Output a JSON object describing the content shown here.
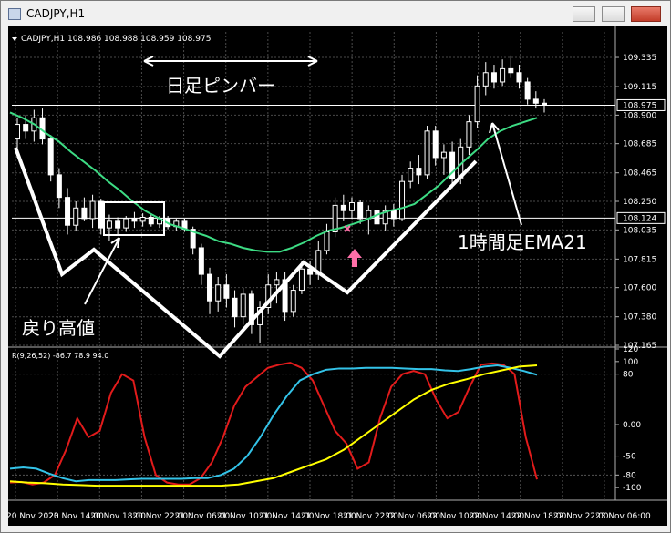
{
  "window": {
    "title": "CADJPY,H1"
  },
  "chart_data": [
    {
      "type": "candlestick",
      "title": "CADJPY,H1  108.986 108.988 108.959 108.975",
      "ylim": [
        107.165,
        109.5
      ],
      "y_ticks": [
        "109.335",
        "109.115",
        "108.900",
        "108.685",
        "108.465",
        "108.250",
        "108.035",
        "107.815",
        "107.600",
        "107.380",
        "107.165"
      ],
      "x_ticks": [
        "20 Nov 2023",
        "20 Nov 14:00",
        "20 Nov 18:00",
        "20 Nov 22:00",
        "21 Nov 06:00",
        "21 Nov 10:00",
        "21 Nov 14:00",
        "21 Nov 18:00",
        "21 Nov 22:00",
        "22 Nov 06:00",
        "22 Nov 10:00",
        "22 Nov 14:00",
        "22 Nov 18:00",
        "22 Nov 22:00",
        "23 Nov 06:00"
      ],
      "price_labels": [
        {
          "label": "108.975",
          "value": 108.975,
          "color": "#ffffff"
        },
        {
          "label": "108.124",
          "value": 108.124,
          "color": "#ffffff"
        }
      ],
      "horizontal_lines": [
        108.975,
        108.124
      ],
      "candles": [
        {
          "o": 108.72,
          "h": 108.88,
          "l": 108.58,
          "c": 108.83
        },
        {
          "o": 108.83,
          "h": 108.9,
          "l": 108.72,
          "c": 108.78
        },
        {
          "o": 108.78,
          "h": 108.94,
          "l": 108.7,
          "c": 108.88
        },
        {
          "o": 108.88,
          "h": 108.95,
          "l": 108.68,
          "c": 108.72
        },
        {
          "o": 108.72,
          "h": 108.75,
          "l": 108.4,
          "c": 108.45
        },
        {
          "o": 108.45,
          "h": 108.5,
          "l": 108.2,
          "c": 108.28
        },
        {
          "o": 108.28,
          "h": 108.35,
          "l": 108.0,
          "c": 108.07
        },
        {
          "o": 108.07,
          "h": 108.25,
          "l": 108.03,
          "c": 108.2
        },
        {
          "o": 108.2,
          "h": 108.28,
          "l": 108.1,
          "c": 108.12
        },
        {
          "o": 108.12,
          "h": 108.3,
          "l": 108.05,
          "c": 108.25
        },
        {
          "o": 108.25,
          "h": 108.27,
          "l": 108.0,
          "c": 108.05
        },
        {
          "o": 108.05,
          "h": 108.15,
          "l": 107.95,
          "c": 108.1
        },
        {
          "o": 108.1,
          "h": 108.13,
          "l": 108.0,
          "c": 108.05
        },
        {
          "o": 108.05,
          "h": 108.14,
          "l": 108.02,
          "c": 108.12
        },
        {
          "o": 108.12,
          "h": 108.17,
          "l": 108.05,
          "c": 108.1
        },
        {
          "o": 108.1,
          "h": 108.16,
          "l": 108.06,
          "c": 108.13
        },
        {
          "o": 108.13,
          "h": 108.16,
          "l": 108.06,
          "c": 108.08
        },
        {
          "o": 108.08,
          "h": 108.14,
          "l": 108.05,
          "c": 108.12
        },
        {
          "o": 108.12,
          "h": 108.14,
          "l": 108.04,
          "c": 108.06
        },
        {
          "o": 108.06,
          "h": 108.12,
          "l": 108.03,
          "c": 108.1
        },
        {
          "o": 108.1,
          "h": 108.12,
          "l": 108.02,
          "c": 108.04
        },
        {
          "o": 108.04,
          "h": 108.06,
          "l": 107.85,
          "c": 107.9
        },
        {
          "o": 107.9,
          "h": 107.93,
          "l": 107.62,
          "c": 107.7
        },
        {
          "o": 107.7,
          "h": 107.75,
          "l": 107.4,
          "c": 107.5
        },
        {
          "o": 107.5,
          "h": 107.68,
          "l": 107.42,
          "c": 107.62
        },
        {
          "o": 107.62,
          "h": 107.7,
          "l": 107.45,
          "c": 107.52
        },
        {
          "o": 107.52,
          "h": 107.58,
          "l": 107.3,
          "c": 107.38
        },
        {
          "o": 107.38,
          "h": 107.6,
          "l": 107.32,
          "c": 107.55
        },
        {
          "o": 107.55,
          "h": 107.58,
          "l": 107.25,
          "c": 107.32
        },
        {
          "o": 107.32,
          "h": 107.5,
          "l": 107.18,
          "c": 107.45
        },
        {
          "o": 107.45,
          "h": 107.7,
          "l": 107.4,
          "c": 107.62
        },
        {
          "o": 107.62,
          "h": 107.72,
          "l": 107.48,
          "c": 107.66
        },
        {
          "o": 107.66,
          "h": 107.72,
          "l": 107.35,
          "c": 107.42
        },
        {
          "o": 107.42,
          "h": 107.62,
          "l": 107.38,
          "c": 107.58
        },
        {
          "o": 107.58,
          "h": 107.8,
          "l": 107.55,
          "c": 107.74
        },
        {
          "o": 107.74,
          "h": 107.8,
          "l": 107.62,
          "c": 107.7
        },
        {
          "o": 107.7,
          "h": 107.95,
          "l": 107.66,
          "c": 107.88
        },
        {
          "o": 107.88,
          "h": 108.08,
          "l": 107.85,
          "c": 108.02
        },
        {
          "o": 108.02,
          "h": 108.28,
          "l": 107.98,
          "c": 108.22
        },
        {
          "o": 108.22,
          "h": 108.3,
          "l": 108.1,
          "c": 108.18
        },
        {
          "o": 108.18,
          "h": 108.28,
          "l": 108.12,
          "c": 108.24
        },
        {
          "o": 108.24,
          "h": 108.26,
          "l": 108.08,
          "c": 108.12
        },
        {
          "o": 108.12,
          "h": 108.22,
          "l": 108.0,
          "c": 108.18
        },
        {
          "o": 108.18,
          "h": 108.24,
          "l": 108.04,
          "c": 108.08
        },
        {
          "o": 108.08,
          "h": 108.22,
          "l": 108.03,
          "c": 108.18
        },
        {
          "o": 108.18,
          "h": 108.23,
          "l": 108.06,
          "c": 108.12
        },
        {
          "o": 108.12,
          "h": 108.45,
          "l": 108.1,
          "c": 108.4
        },
        {
          "o": 108.4,
          "h": 108.55,
          "l": 108.35,
          "c": 108.5
        },
        {
          "o": 108.5,
          "h": 108.6,
          "l": 108.38,
          "c": 108.45
        },
        {
          "o": 108.45,
          "h": 108.82,
          "l": 108.42,
          "c": 108.78
        },
        {
          "o": 108.78,
          "h": 108.82,
          "l": 108.52,
          "c": 108.58
        },
        {
          "o": 108.58,
          "h": 108.68,
          "l": 108.45,
          "c": 108.62
        },
        {
          "o": 108.62,
          "h": 108.7,
          "l": 108.35,
          "c": 108.42
        },
        {
          "o": 108.42,
          "h": 108.72,
          "l": 108.38,
          "c": 108.66
        },
        {
          "o": 108.66,
          "h": 108.9,
          "l": 108.6,
          "c": 108.85
        },
        {
          "o": 108.85,
          "h": 109.2,
          "l": 108.8,
          "c": 109.12
        },
        {
          "o": 109.12,
          "h": 109.3,
          "l": 109.05,
          "c": 109.22
        },
        {
          "o": 109.22,
          "h": 109.28,
          "l": 109.1,
          "c": 109.15
        },
        {
          "o": 109.15,
          "h": 109.32,
          "l": 109.12,
          "c": 109.25
        },
        {
          "o": 109.25,
          "h": 109.35,
          "l": 109.18,
          "c": 109.22
        },
        {
          "o": 109.22,
          "h": 109.28,
          "l": 109.1,
          "c": 109.15
        },
        {
          "o": 109.15,
          "h": 109.18,
          "l": 108.98,
          "c": 109.02
        },
        {
          "o": 109.02,
          "h": 109.08,
          "l": 108.95,
          "c": 108.99
        },
        {
          "o": 108.99,
          "h": 109.02,
          "l": 108.92,
          "c": 108.975
        }
      ],
      "series": [
        {
          "name": "EMA21",
          "color": "#3ddc84",
          "values": [
            108.92,
            108.88,
            108.83,
            108.76,
            108.7,
            108.62,
            108.55,
            108.48,
            108.4,
            108.33,
            108.25,
            108.18,
            108.13,
            108.08,
            108.05,
            108.02,
            107.99,
            107.95,
            107.93,
            107.9,
            107.88,
            107.87,
            107.87,
            107.9,
            107.94,
            107.99,
            108.03,
            108.05,
            108.08,
            108.11,
            108.15,
            108.18,
            108.2,
            108.23,
            108.3,
            108.37,
            108.46,
            108.55,
            108.63,
            108.72,
            108.78,
            108.82,
            108.85,
            108.88
          ]
        }
      ],
      "annotations": [
        "日足ピンバー",
        "戻り高値",
        "1時間足EMA21"
      ]
    },
    {
      "type": "line",
      "title": "R(9,26,52) -86.7 78.9 94.0",
      "ylim": [
        -120,
        120
      ],
      "y_ticks": [
        "120",
        "100",
        "80",
        "0.00",
        "-50",
        "-80",
        "-100"
      ],
      "series": [
        {
          "name": "R9",
          "color": "#e21b1b",
          "values": [
            -92,
            -91,
            -95,
            -92,
            -80,
            -40,
            10,
            -20,
            -10,
            50,
            80,
            70,
            -20,
            -80,
            -92,
            -95,
            -95,
            -85,
            -60,
            -20,
            30,
            60,
            75,
            90,
            95,
            98,
            90,
            70,
            30,
            -10,
            -30,
            -70,
            -60,
            10,
            60,
            80,
            85,
            80,
            40,
            10,
            20,
            60,
            95,
            97,
            95,
            80,
            -20,
            -87
          ]
        },
        {
          "name": "R26",
          "color": "#33c3e8",
          "values": [
            -70,
            -68,
            -70,
            -78,
            -85,
            -90,
            -88,
            -88,
            -88,
            -87,
            -86,
            -86,
            -86,
            -86,
            -85,
            -85,
            -80,
            -70,
            -50,
            -20,
            15,
            45,
            70,
            80,
            87,
            89,
            89,
            90,
            90,
            90,
            89,
            88,
            88,
            86,
            85,
            88,
            92,
            94,
            90,
            85,
            79
          ]
        },
        {
          "name": "R52",
          "color": "#ffff00",
          "values": [
            -90,
            -92,
            -93,
            -95,
            -96,
            -97,
            -97,
            -97,
            -97,
            -97,
            -97,
            -97,
            -97,
            -95,
            -90,
            -85,
            -75,
            -65,
            -55,
            -40,
            -20,
            0,
            20,
            40,
            55,
            65,
            72,
            80,
            86,
            92,
            94
          ]
        }
      ]
    }
  ]
}
